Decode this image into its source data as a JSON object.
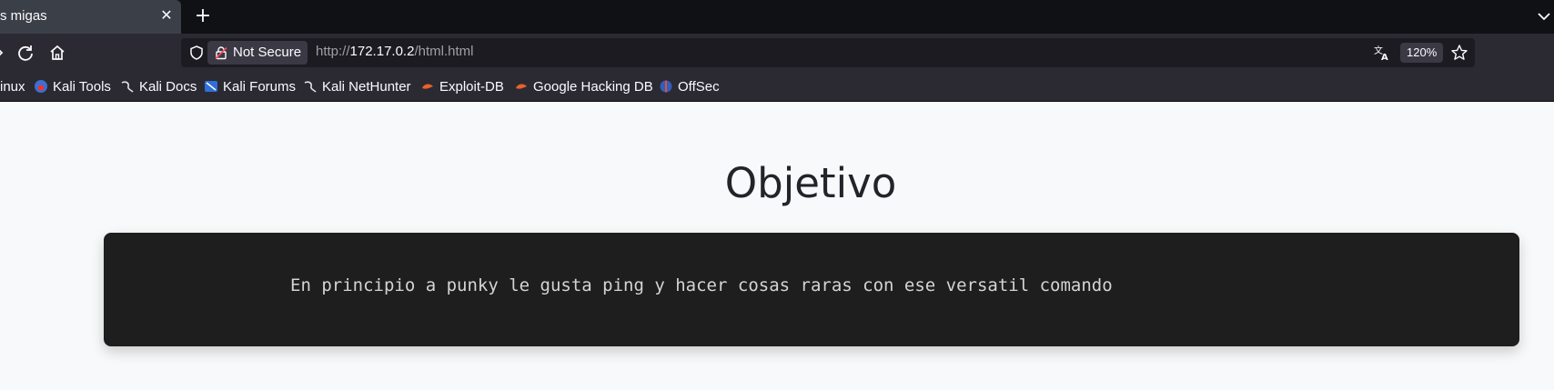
{
  "browser": {
    "tab": {
      "title": "s migas"
    },
    "toolbar": {
      "security_label": "Not Secure",
      "url_prefix": "http://",
      "url_host": "172.17.0.2",
      "url_path": "/html.html",
      "zoom": "120%"
    },
    "bookmarks": [
      {
        "label": "inux",
        "icon": "kali-dragon-icon"
      },
      {
        "label": "Kali Tools",
        "icon": "kali-tools-icon"
      },
      {
        "label": "Kali Docs",
        "icon": "kali-dragon-icon"
      },
      {
        "label": "Kali Forums",
        "icon": "kali-forums-icon"
      },
      {
        "label": "Kali NetHunter",
        "icon": "kali-dragon-icon"
      },
      {
        "label": "Exploit-DB",
        "icon": "exploit-db-icon"
      },
      {
        "label": "Google Hacking DB",
        "icon": "exploit-db-icon"
      },
      {
        "label": "OffSec",
        "icon": "offsec-icon"
      }
    ]
  },
  "page": {
    "title": "Objetivo",
    "objective_text": "En principio a punky le gusta ping y hacer cosas raras con ese versatil comando"
  }
}
